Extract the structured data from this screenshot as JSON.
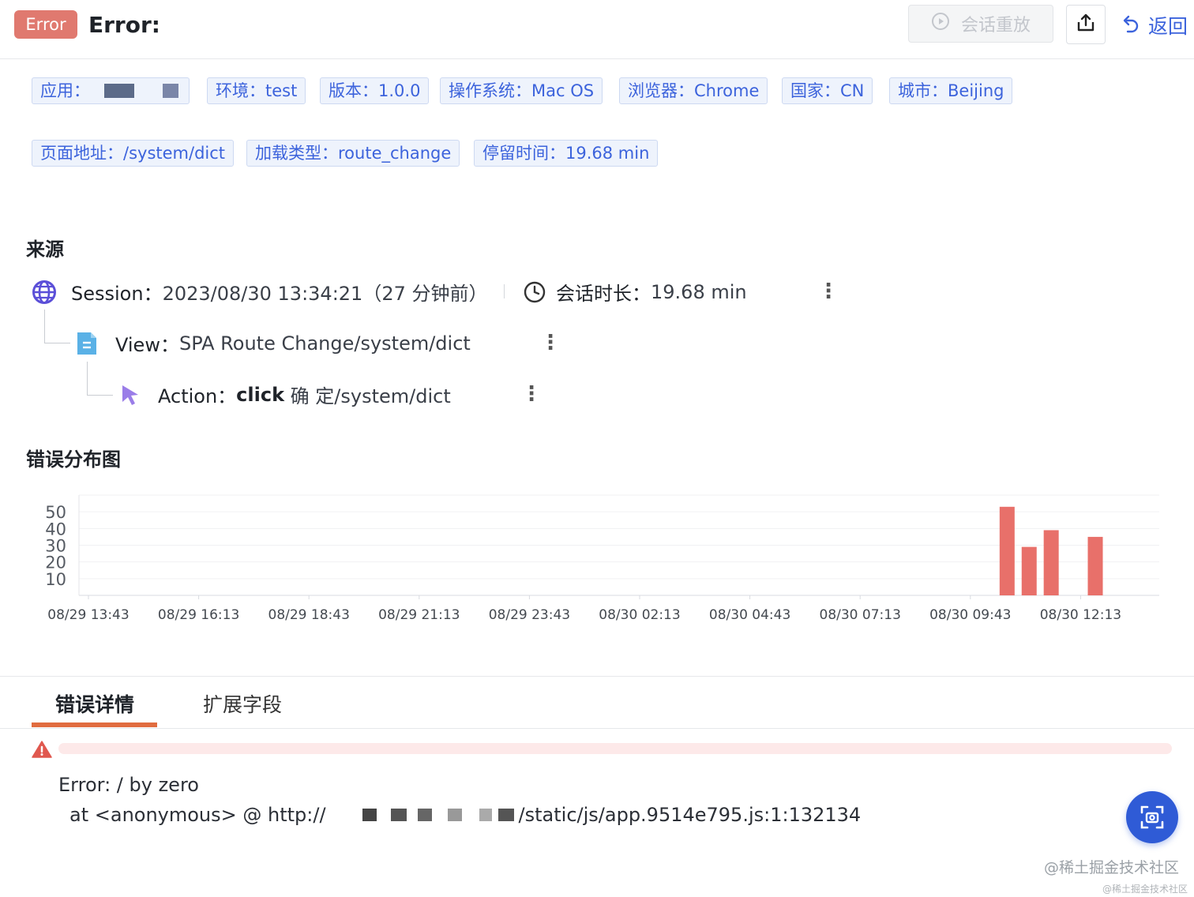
{
  "header": {
    "badge": "Error",
    "title": "Error:",
    "replay_label": "会话重放",
    "back_label": "返回"
  },
  "tags": {
    "row1": [
      "应用：",
      "环境：test",
      "版本：1.0.0",
      "操作系统：Mac OS",
      "浏览器：Chrome",
      "国家：CN",
      "城市：Beijing"
    ],
    "row2": [
      "页面地址：/system/dict",
      "加载类型：route_change",
      "停留时间：19.68 min"
    ]
  },
  "source": {
    "title": "来源",
    "session_label": "Session：",
    "session_value": "2023/08/30 13:34:21（27 分钟前）",
    "duration_label": "会话时长：",
    "duration_value": "19.68 min",
    "view_label": "View：",
    "view_value": "SPA Route Change/system/dict",
    "action_label": "Action：",
    "action_bold": "click",
    "action_value": " 确 定/system/dict"
  },
  "chart_title": "错误分布图",
  "chart_data": {
    "type": "bar",
    "y_ticks": [
      10,
      20,
      30,
      40,
      50
    ],
    "ylim": [
      0,
      60
    ],
    "x_labels": [
      "08/29 13:43",
      "08/29 16:13",
      "08/29 18:43",
      "08/29 21:13",
      "08/29 23:43",
      "08/30 02:13",
      "08/30 04:43",
      "08/30 07:13",
      "08/30 09:43",
      "08/30 12:13"
    ],
    "bars": [
      {
        "x": "08/30 10:33",
        "value": 53
      },
      {
        "x": "08/30 11:03",
        "value": 29
      },
      {
        "x": "08/30 11:33",
        "value": 39
      },
      {
        "x": "08/30 12:33",
        "value": 35
      }
    ],
    "bar_color": "#e8706a",
    "grid": true
  },
  "tabs": {
    "active": "错误详情",
    "second": "扩展字段"
  },
  "error": {
    "line1": "Error: / by zero",
    "line2_prefix": "at <anonymous> @ http://",
    "line2_suffix": "/static/js/app.9514e795.js:1:132134"
  },
  "watermark": "@稀土掘金技术社区"
}
